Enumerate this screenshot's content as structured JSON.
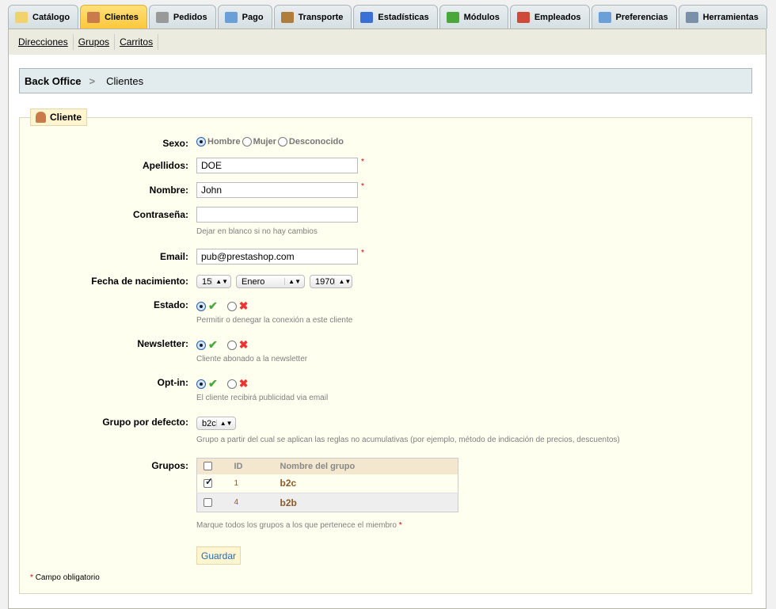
{
  "tabs": [
    {
      "label": "Catálogo",
      "icon": "folder-icon",
      "color": "#f2d36b"
    },
    {
      "label": "Clientes",
      "icon": "user-icon",
      "color": "#c97b4a",
      "active": true
    },
    {
      "label": "Pedidos",
      "icon": "cart-icon",
      "color": "#999999"
    },
    {
      "label": "Pago",
      "icon": "card-icon",
      "color": "#6a9fd8"
    },
    {
      "label": "Transporte",
      "icon": "truck-icon",
      "color": "#b07d3a"
    },
    {
      "label": "Estadísticas",
      "icon": "bar-chart-icon",
      "color": "#3a6fd8"
    },
    {
      "label": "Módulos",
      "icon": "puzzle-icon",
      "color": "#4aa83a"
    },
    {
      "label": "Empleados",
      "icon": "employee-icon",
      "color": "#d04a3a"
    },
    {
      "label": "Preferencias",
      "icon": "preferences-icon",
      "color": "#6a9fd8"
    },
    {
      "label": "Herramientas",
      "icon": "wrench-icon",
      "color": "#7a8fa8"
    }
  ],
  "subnav": [
    "Direcciones",
    "Grupos",
    "Carritos"
  ],
  "breadcrumb": {
    "root": "Back Office",
    "current": "Clientes"
  },
  "legend": "Cliente",
  "form": {
    "sexo": {
      "label": "Sexo:",
      "options": [
        "Hombre",
        "Mujer",
        "Desconocido"
      ],
      "selected": "Hombre"
    },
    "apellidos": {
      "label": "Apellidos:",
      "value": "DOE"
    },
    "nombre": {
      "label": "Nombre:",
      "value": "John"
    },
    "password": {
      "label": "Contraseña:",
      "value": "",
      "hint": "Dejar en blanco si no hay cambios"
    },
    "email": {
      "label": "Email:",
      "value": "pub@prestashop.com"
    },
    "birth": {
      "label": "Fecha de nacimiento:",
      "day": "15",
      "month": "Enero",
      "year": "1970"
    },
    "estado": {
      "label": "Estado:",
      "hint": "Permitir o denegar la conexión a este cliente"
    },
    "newsletter": {
      "label": "Newsletter:",
      "hint": "Cliente abonado a la newsletter"
    },
    "optin": {
      "label": "Opt-in:",
      "hint": "El cliente recibirá publicidad via email"
    },
    "default_group": {
      "label": "Grupo por defecto:",
      "value": "b2c",
      "hint": "Grupo a partir del cual se aplican las reglas no acumulativas (por ejemplo, método de indicación de precios, descuentos)"
    },
    "groups": {
      "label": "Grupos:",
      "headers": [
        "ID",
        "Nombre del grupo"
      ],
      "rows": [
        {
          "id": "1",
          "name": "b2c",
          "checked": true
        },
        {
          "id": "4",
          "name": "b2b",
          "checked": false
        }
      ],
      "hint": "Marque todos los grupos a los que pertenece el miembro"
    },
    "req": "*",
    "save": "Guardar",
    "required_note": "Campo obligatorio"
  }
}
